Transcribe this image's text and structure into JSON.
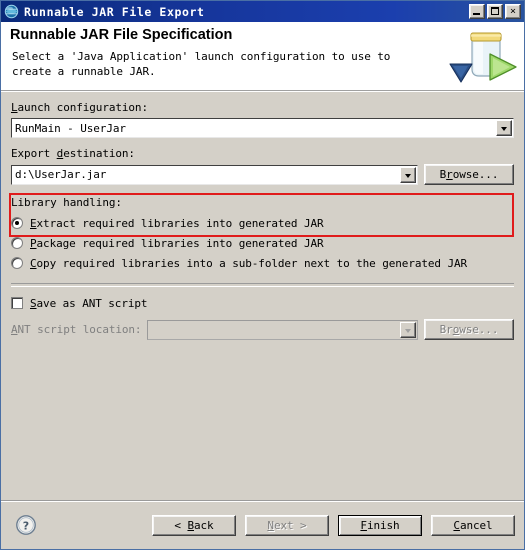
{
  "window": {
    "title": "Runnable JAR File Export",
    "icon": "eclipse-jar-icon",
    "minimize_label": "Minimize",
    "maximize_label": "Maximize",
    "close_label": "×"
  },
  "header": {
    "title": "Runnable JAR File Specification",
    "description": "Select a 'Java Application' launch configuration to use to create a runnable JAR.",
    "art": "jar-export-illustration"
  },
  "form": {
    "launch_configuration": {
      "label": "Launch configuration:",
      "value": "RunMain - UserJar",
      "highlighted": true,
      "highlight_color": "#e01b1b"
    },
    "export_destination": {
      "label": "Export destination:",
      "value": "d:\\UserJar.jar",
      "browse_label": "Browse..."
    },
    "library_handling": {
      "label": "Library handling:",
      "options": [
        {
          "label": "Extract required libraries into generated JAR",
          "selected": true
        },
        {
          "label": "Package required libraries into generated JAR",
          "selected": false
        },
        {
          "label": "Copy required libraries into a sub-folder next to the generated JAR",
          "selected": false
        }
      ]
    },
    "ant_script": {
      "checkbox_label": "Save as ANT script",
      "checked": false,
      "location_label": "ANT script location:",
      "location_value": "",
      "browse_label": "Browse...",
      "disabled": true
    }
  },
  "footer": {
    "help_icon": "help-question-icon",
    "buttons": [
      {
        "label": "< Back",
        "disabled": false,
        "default": false
      },
      {
        "label": "Next >",
        "disabled": true,
        "default": false
      },
      {
        "label": "Finish",
        "disabled": false,
        "default": true
      },
      {
        "label": "Cancel",
        "disabled": false,
        "default": false
      }
    ]
  }
}
